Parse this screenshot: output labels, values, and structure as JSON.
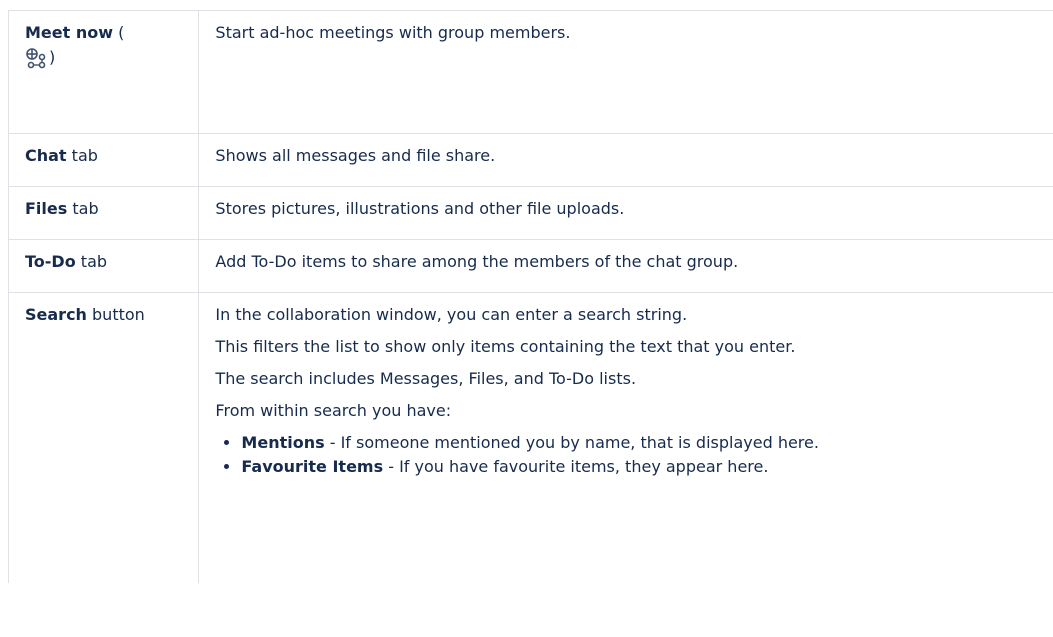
{
  "rows": [
    {
      "term_bold": "Meet now",
      "term_rest_open": " (",
      "term_rest_close": ")",
      "icon": "meet-now-icon",
      "description": "Start ad-hoc meetings with group members."
    },
    {
      "term_bold": "Chat",
      "term_rest": " tab",
      "description": "Shows all messages and file share."
    },
    {
      "term_bold": "Files",
      "term_rest": " tab",
      "description": "Stores pictures, illustrations and other file uploads."
    },
    {
      "term_bold": "To-Do",
      "term_rest": " tab",
      "description": "Add To-Do items to share among the members of the chat group."
    },
    {
      "term_bold": "Search",
      "term_rest": " button",
      "paragraphs": [
        "In the collaboration window, you can enter a search string.",
        "This filters the list to show only items containing the text that you enter.",
        "The search includes Messages, Files, and To-Do lists.",
        "From within search you have:"
      ],
      "bullets": [
        {
          "bold": "Mentions",
          "text": " - If someone mentioned you by name, that is displayed here."
        },
        {
          "bold": "Favourite Items",
          "text": " - If you have favourite items, they appear here."
        }
      ]
    }
  ]
}
